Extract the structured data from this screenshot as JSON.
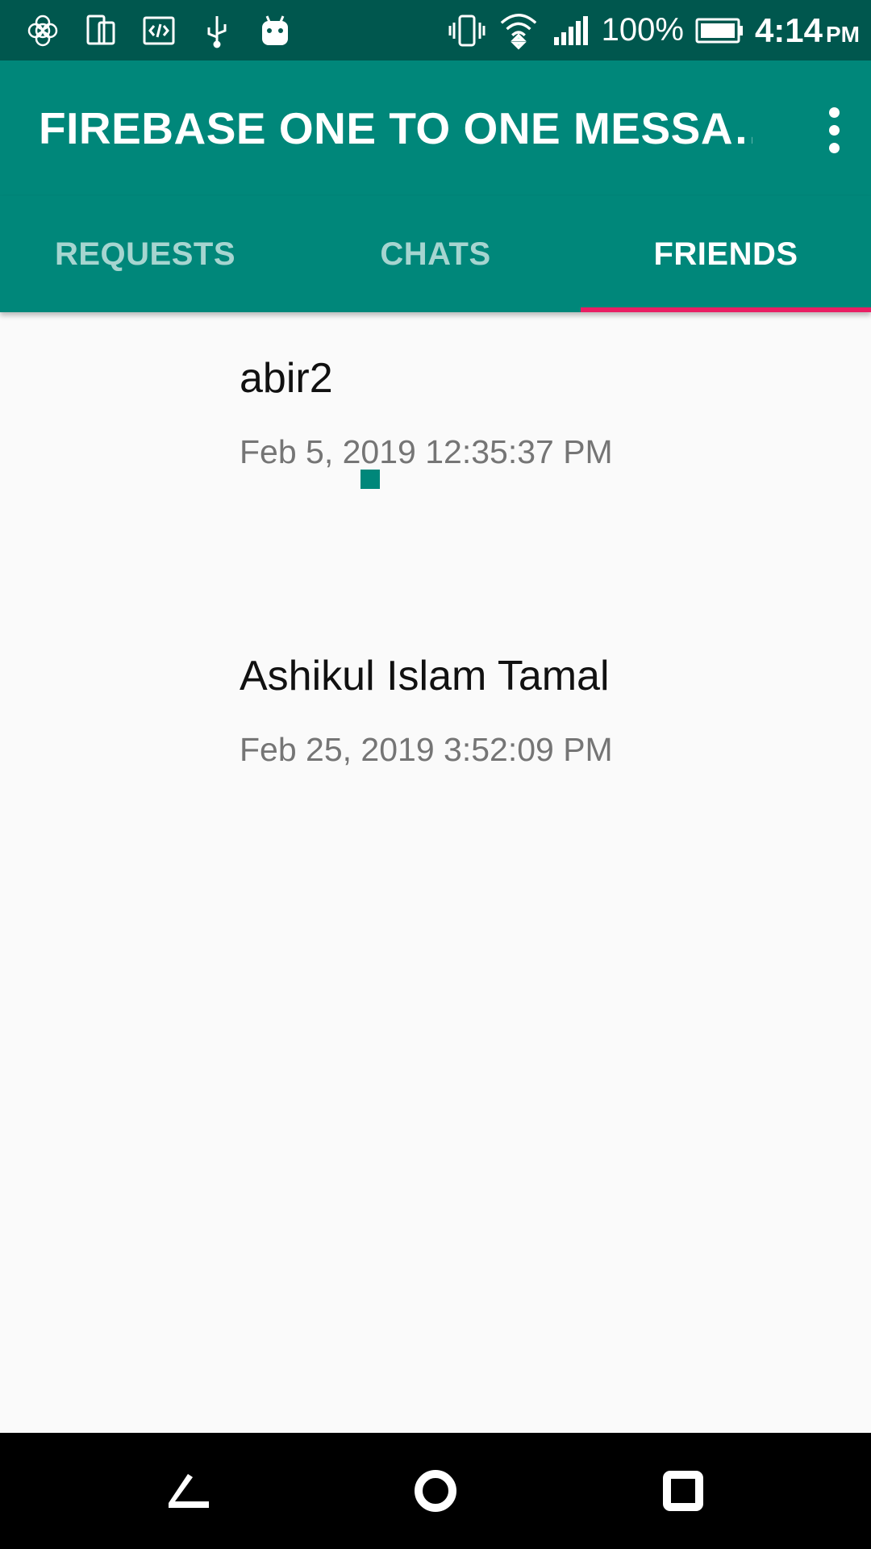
{
  "status_bar": {
    "left_icons": [
      "app-cube-icon",
      "device-icon",
      "code-icon",
      "usb-icon",
      "android-icon"
    ],
    "battery_percent": "100%",
    "time": "4:14",
    "ampm": "PM"
  },
  "app_bar": {
    "title": "FIREBASE ONE TO ONE MESSA…"
  },
  "tabs": [
    {
      "label": "REQUESTS",
      "active": false
    },
    {
      "label": "CHATS",
      "active": false
    },
    {
      "label": "FRIENDS",
      "active": true
    }
  ],
  "friends": [
    {
      "name": "abir2",
      "date": "Feb 5, 2019 12:35:37 PM"
    },
    {
      "name": "Ashikul Islam Tamal",
      "date": "Feb 25, 2019 3:52:09 PM"
    }
  ],
  "colors": {
    "status_bar": "#00574e",
    "primary": "#00877a",
    "accent": "#e91e63",
    "background": "#fafafa"
  },
  "nav_bar": [
    "back-icon",
    "home-icon",
    "recents-icon"
  ]
}
